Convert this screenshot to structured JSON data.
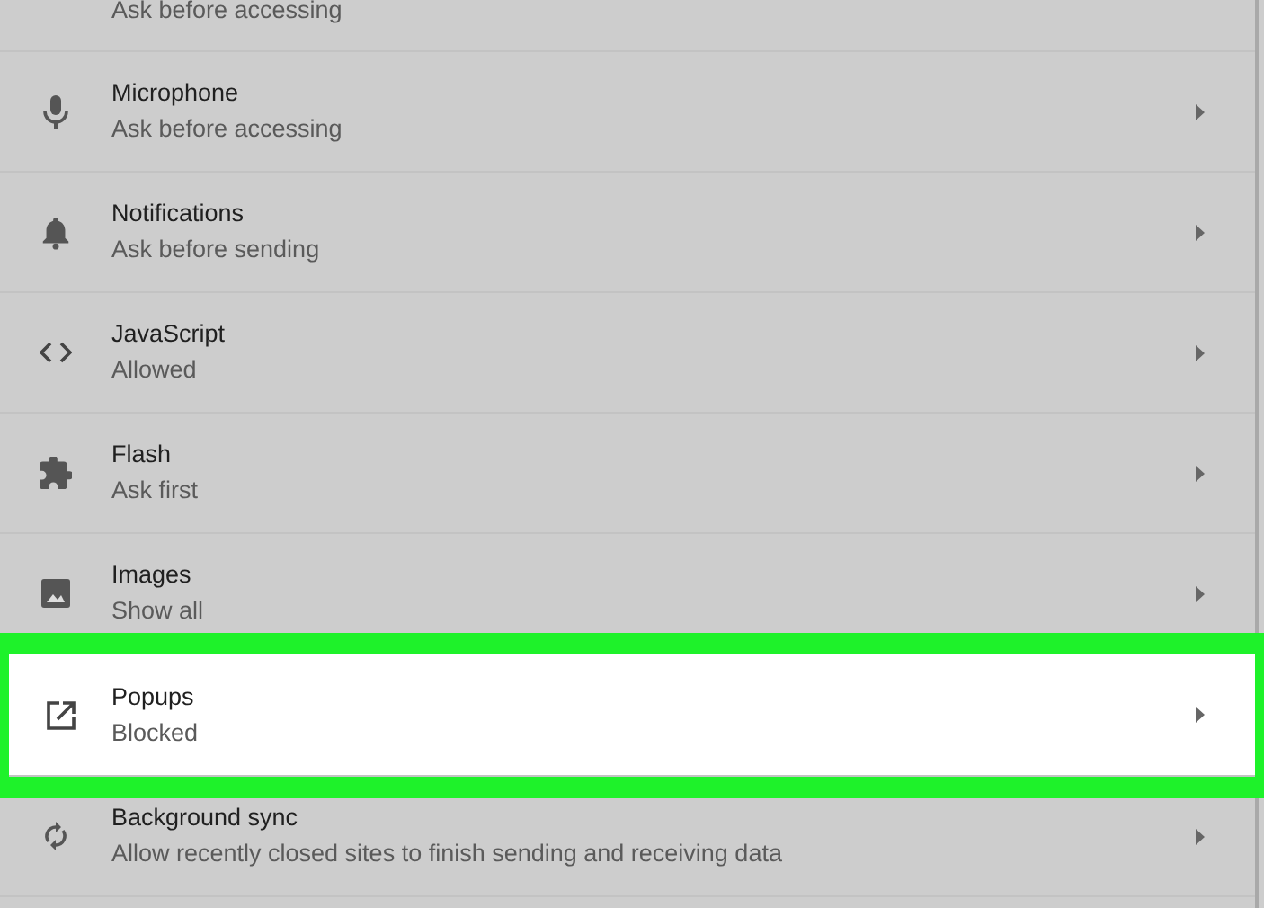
{
  "settings_items": [
    {
      "subtitle": "Ask before accessing",
      "highlighted": false
    },
    {
      "title": "Microphone",
      "subtitle": "Ask before accessing",
      "highlighted": false
    },
    {
      "title": "Notifications",
      "subtitle": "Ask before sending",
      "highlighted": false
    },
    {
      "title": "JavaScript",
      "subtitle": "Allowed",
      "highlighted": false
    },
    {
      "title": "Flash",
      "subtitle": "Ask first",
      "highlighted": false
    },
    {
      "title": "Images",
      "subtitle": "Show all",
      "highlighted": false
    },
    {
      "title": "Popups",
      "subtitle": "Blocked",
      "highlighted": true
    },
    {
      "title": "Background sync",
      "subtitle": "Allow recently closed sites to finish sending and receiving data",
      "highlighted": false
    }
  ]
}
